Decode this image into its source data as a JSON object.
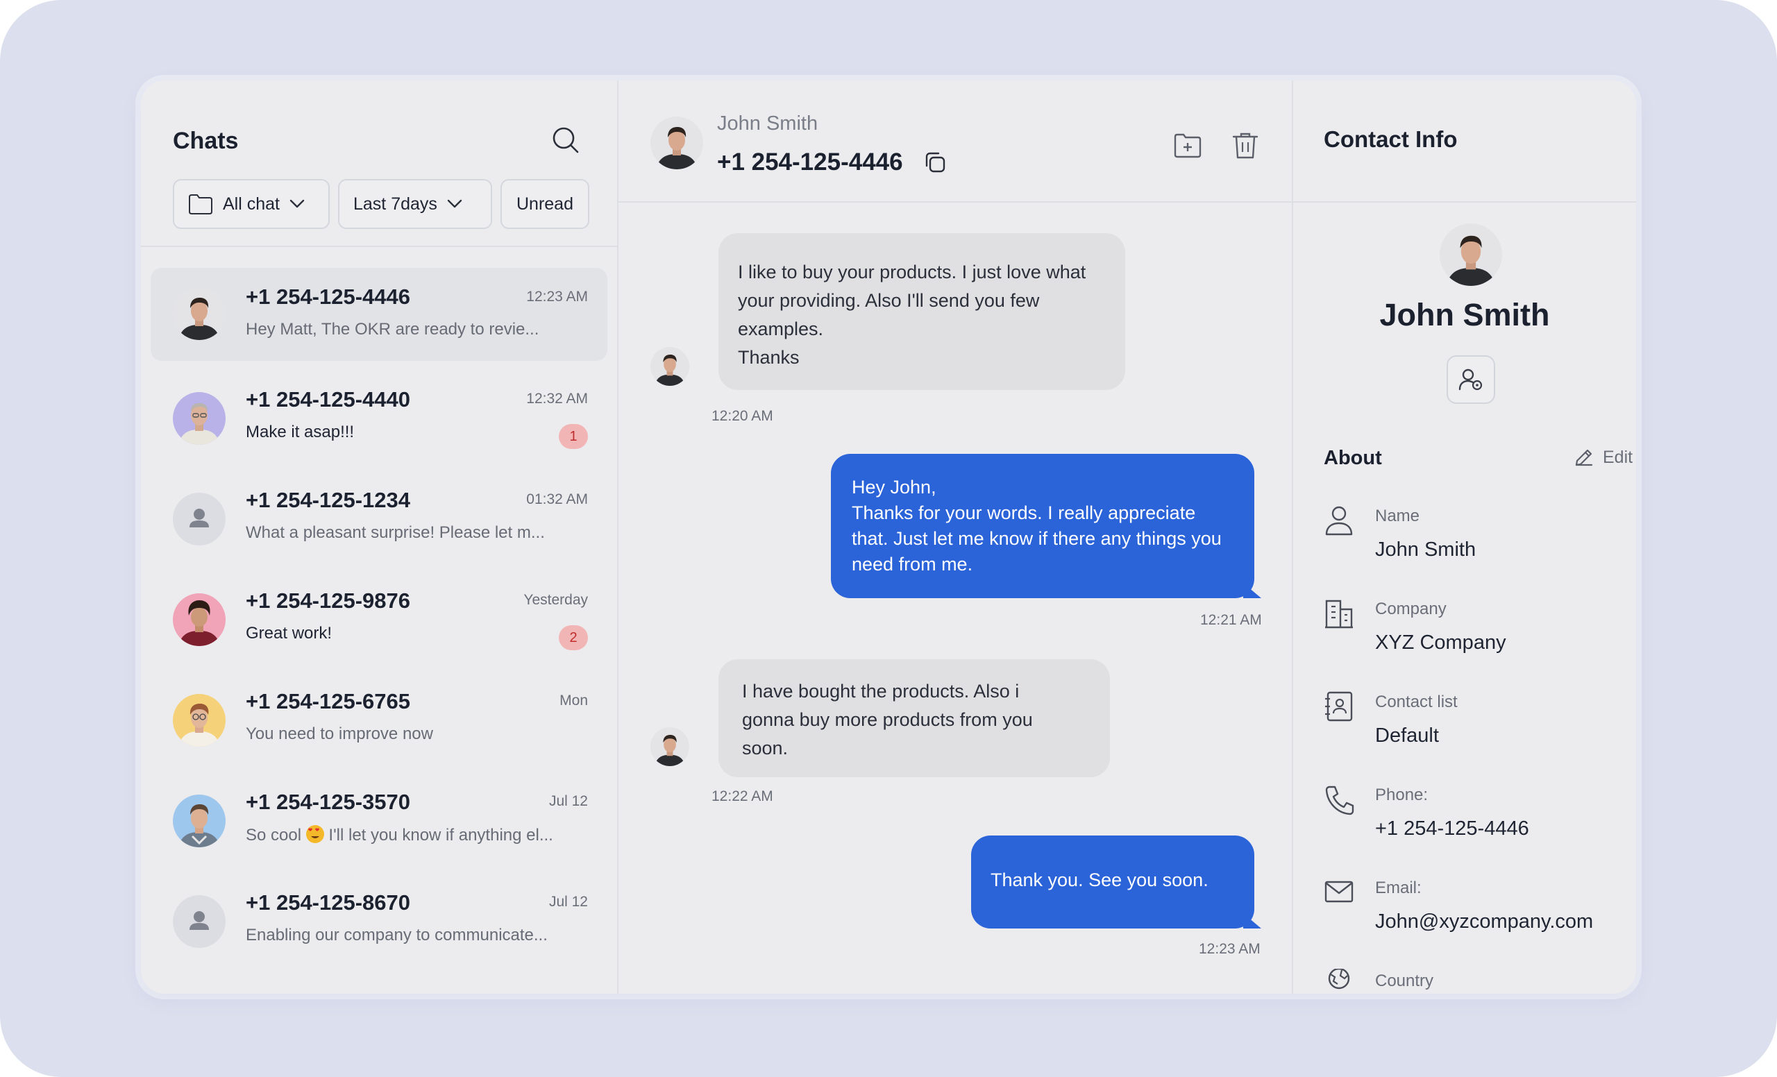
{
  "sidebar": {
    "title": "Chats",
    "filters": {
      "folder": "All chat",
      "range": "Last 7days",
      "unread": "Unread"
    },
    "chats": [
      {
        "phone": "+1 254-125-4446",
        "message": "Hey Matt, The OKR are ready to revie...",
        "time": "12:23 AM",
        "badge": ""
      },
      {
        "phone": "+1 254-125-4440",
        "message": "Make it asap!!!",
        "time": "12:32 AM",
        "badge": "1"
      },
      {
        "phone": "+1 254-125-1234",
        "message": "What a pleasant surprise! Please let m...",
        "time": "01:32 AM",
        "badge": ""
      },
      {
        "phone": "+1 254-125-9876",
        "message": "Great work!",
        "time": "Yesterday",
        "badge": "2"
      },
      {
        "phone": "+1 254-125-6765",
        "message": "You need to improve now",
        "time": "Mon",
        "badge": ""
      },
      {
        "phone": "+1 254-125-3570",
        "message_a": "So cool",
        "message_b": " I'll let you know if anything el...",
        "time": "Jul 12",
        "badge": ""
      },
      {
        "phone": "+1 254-125-8670",
        "message": "Enabling our company to communicate...",
        "time": "Jul 12",
        "badge": ""
      }
    ]
  },
  "conversation": {
    "name": "John Smith",
    "phone": "+1 254-125-4446",
    "messages": [
      {
        "line1": "I like to buy your products. I just love what",
        "line2": "your providing. Also I'll send you few",
        "line3": "examples.",
        "line4": "Thanks",
        "time": "12:20 AM"
      },
      {
        "line1": "Hey John,",
        "line2": "Thanks for your words. I really appreciate",
        "line3": "that. Just let me know if there any things you",
        "line4": "need from me.",
        "time": "12:21 AM"
      },
      {
        "line1": "I have bought the products. Also i",
        "line2": "gonna buy more products from you",
        "line3": "soon.",
        "time": "12:22 AM"
      },
      {
        "line1": "Thank you. See you soon.",
        "time": "12:23 AM"
      }
    ]
  },
  "contact": {
    "title": "Contact Info",
    "name": "John Smith",
    "about_label": "About",
    "edit_label": "Edit",
    "fields": [
      {
        "label": "Name",
        "value": "John Smith",
        "icon": "user-icon"
      },
      {
        "label": "Company",
        "value": "XYZ Company",
        "icon": "building-icon"
      },
      {
        "label": "Contact list",
        "value": "Default",
        "icon": "contact-book-icon"
      },
      {
        "label": "Phone:",
        "value": "+1 254-125-4446",
        "icon": "phone-icon"
      },
      {
        "label": "Email:",
        "value": "John@xyzcompany.com",
        "icon": "mail-icon"
      },
      {
        "label": "Country",
        "value": "",
        "icon": "globe-icon"
      }
    ]
  },
  "colors": {
    "background": "#dcdfee",
    "panel": "#ececee",
    "accent": "#2b63d9",
    "badge": "#f2b5b5",
    "badge_text": "#c12b2b"
  }
}
